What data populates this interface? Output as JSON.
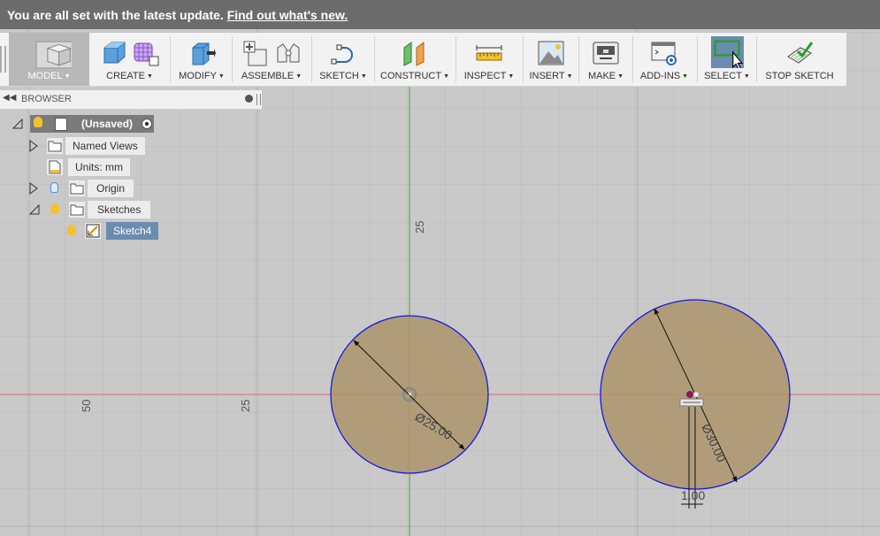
{
  "banner": {
    "message": "You are all set with the latest update.",
    "link": "Find out what's new."
  },
  "toolbar": {
    "model": "MODEL",
    "create": "CREATE",
    "modify": "MODIFY",
    "assemble": "ASSEMBLE",
    "sketch": "SKETCH",
    "construct": "CONSTRUCT",
    "inspect": "INSPECT",
    "insert": "INSERT",
    "make": "MAKE",
    "addins": "ADD-INS",
    "select": "SELECT",
    "stop_sketch": "STOP SKETCH"
  },
  "browser": {
    "title": "BROWSER",
    "root": "(Unsaved)",
    "items": [
      {
        "label": "Named Views"
      },
      {
        "label": "Units: mm"
      },
      {
        "label": "Origin"
      },
      {
        "label": "Sketches"
      },
      {
        "label": "Sketch4"
      }
    ]
  },
  "canvas": {
    "axis_labels": {
      "v25": "25",
      "h25": "25",
      "h50": "50"
    },
    "dimensions": {
      "circle1": "Ø25.00",
      "circle2": "Ø30.00",
      "offset": "1.00"
    }
  },
  "colors": {
    "x_axis": "#d86a6a",
    "y_axis": "#4fb24f",
    "circle_fill": "#ab946b",
    "circle_stroke": "#1818d8",
    "selection": "#6a8caf"
  }
}
